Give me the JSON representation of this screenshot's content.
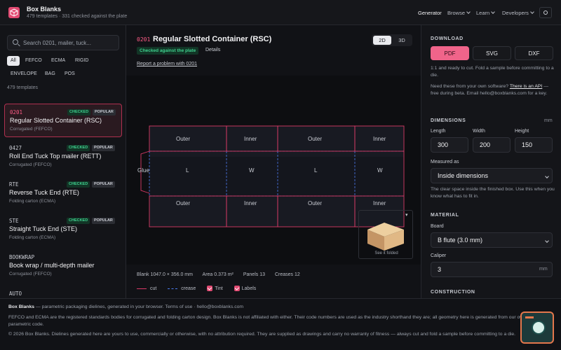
{
  "header": {
    "title": "Box Blanks",
    "subtitle": "479 templates · 331 checked against the plate",
    "nav": [
      {
        "label": "Generator",
        "active": true,
        "dropdown": false
      },
      {
        "label": "Browse",
        "dropdown": true
      },
      {
        "label": "Learn",
        "dropdown": true
      },
      {
        "label": "Developers",
        "dropdown": true
      }
    ],
    "theme_icon": "sun-icon"
  },
  "sidebar": {
    "search_placeholder": "Search 0201, mailer, tuck...",
    "chips": [
      "All",
      "FEFCO",
      "ECMA",
      "RIGID",
      "ENVELOPE",
      "BAG",
      "POS"
    ],
    "active_chip": "All",
    "count": "479 templates",
    "items": [
      {
        "code": "0201",
        "name": "Regular Slotted Container (RSC)",
        "category": "Corrugated (FEFCO)",
        "badges": [
          "CHECKED",
          "POPULAR"
        ],
        "selected": true
      },
      {
        "code": "0427",
        "name": "Roll End Tuck Top mailer (RETT)",
        "category": "Corrugated (FEFCO)",
        "badges": [
          "CHECKED",
          "POPULAR"
        ]
      },
      {
        "code": "RTE",
        "name": "Reverse Tuck End (RTE)",
        "category": "Folding carton (ECMA)",
        "badges": [
          "CHECKED",
          "POPULAR"
        ]
      },
      {
        "code": "STE",
        "name": "Straight Tuck End (STE)",
        "category": "Folding carton (ECMA)",
        "badges": [
          "CHECKED",
          "POPULAR"
        ]
      },
      {
        "code": "BOOKWRAP",
        "name": "Book wrap / multi-depth mailer",
        "category": "Corrugated (FEFCO)",
        "badges": []
      },
      {
        "code": "AUTO",
        "name": "",
        "category": "",
        "badges": []
      }
    ]
  },
  "main": {
    "code": "0201",
    "title": "Regular Slotted Container (RSC)",
    "checked_badge": "Checked against the plate",
    "details_link": "Details",
    "report_link": "Report a problem with 0201",
    "view_toggle": [
      "2D",
      "3D"
    ],
    "active_view": "2D",
    "dieline": {
      "top_flaps": [
        "Outer",
        "Inner",
        "Outer",
        "Inner"
      ],
      "panels": [
        "L",
        "W",
        "L",
        "W"
      ],
      "bottom_flaps": [
        "Outer",
        "Inner",
        "Outer",
        "Inner"
      ],
      "glue": "Glue"
    },
    "preview_caption": "See it folded",
    "preview_menu": "▾",
    "stats": {
      "blank": "Blank 1047.0 × 356.0 mm",
      "area": "Area 0.373 m²",
      "panels": "Panels 13",
      "creases": "Creases 12"
    },
    "legend": {
      "cut": "cut",
      "crease": "crease",
      "tint": "Tint",
      "labels": "Labels"
    },
    "colors": {
      "cut": "#d93a66",
      "crease": "#4c7cf0",
      "accent": "#f0648a"
    }
  },
  "right": {
    "download_heading": "DOWNLOAD",
    "download_buttons": [
      "PDF",
      "SVG",
      "DXF"
    ],
    "download_note": "1:1 and ready to cut. Fold a sample before committing to a die.",
    "api_note_prefix": "Need these from your own software?",
    "api_link": "There is an API",
    "api_note_suffix": "— free during beta. Email hello@boxblanks.com for a key.",
    "dimensions_heading": "DIMENSIONS",
    "dimensions_unit": "mm",
    "length_label": "Length",
    "length_value": "300",
    "width_label": "Width",
    "width_value": "200",
    "height_label": "Height",
    "height_value": "150",
    "measured_label": "Measured as",
    "measured_value": "Inside dimensions",
    "measured_note": "The clear space inside the finished box. Use this when you know what has to fit in.",
    "material_heading": "MATERIAL",
    "board_label": "Board",
    "board_value": "B flute (3.0 mm)",
    "caliper_label": "Caliper",
    "caliper_value": "3",
    "caliper_unit": "mm",
    "construction_heading": "CONSTRUCTION"
  },
  "footer": {
    "line1_brand": "Box Blanks",
    "line1_rest": "— parametric packaging dielines, generated in your browser. Terms of use · hello@boxblanks.com",
    "line2": "FEFCO and ECMA are the registered standards bodies for corrugated and folding carton design. Box Blanks is not affiliated with either. Their code numbers are used as the industry shorthand they are; all geometry here is generated from our own parametric code.",
    "line3": "© 2026 Box Blanks. Dielines generated here are yours to use, commercially or otherwise, with no attribution required. They are supplied as drawings and carry no warranty of fitness — always cut and fold a sample before committing to a die."
  }
}
